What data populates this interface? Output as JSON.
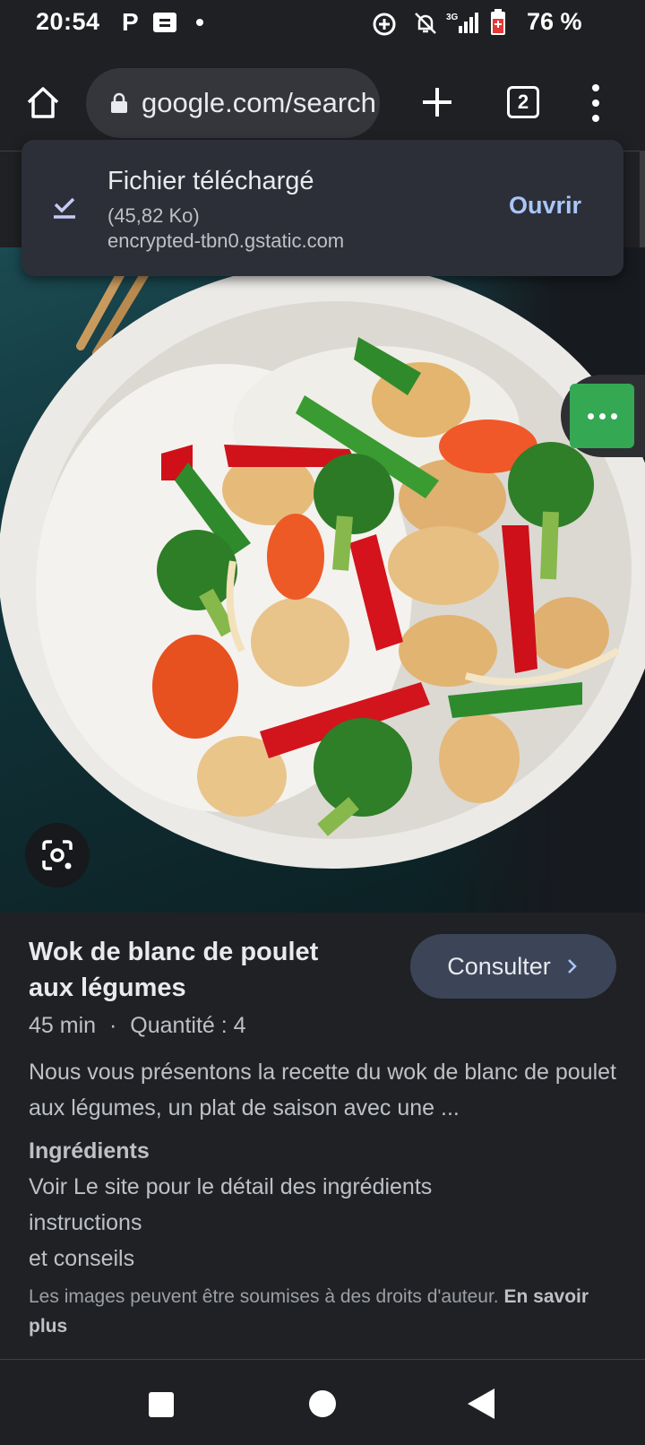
{
  "status_bar": {
    "time": "20:54",
    "left_icons": [
      "p-icon",
      "message-icon",
      "dot-icon"
    ],
    "battery_percent": "76 %",
    "right_icons": [
      "data-saver-icon",
      "notifications-off-icon",
      "signal-3g-icon",
      "battery-icon"
    ]
  },
  "toolbar": {
    "url": "google.com/search",
    "tab_count": "2"
  },
  "snackbar": {
    "title": "Fichier téléchargé",
    "size": "(45,82 Ko)",
    "host": "encrypted-tbn0.gstatic.com",
    "action": "Ouvrir"
  },
  "result": {
    "title": "Wok de blanc de poulet aux légumes",
    "consult_label": "Consulter",
    "time": "45 min",
    "separator": "·",
    "quantity": "Quantité : 4",
    "description": "Nous vous présentons la recette du wok de blanc de poulet aux légumes, un plat de saison avec une ...",
    "ingredients_title": "Ingrédients",
    "ingredients_lines": [
      "Voir Le site pour le détail des ingrédients",
      "instructions",
      "et conseils"
    ],
    "copyright_text": "Les images peuvent être soumises à des droits d'auteur.",
    "copyright_link": "En savoir plus"
  },
  "colors": {
    "background": "#202124",
    "accent_link": "#a8c7fa",
    "fab_green": "#34a853",
    "consult_button": "#3c4458"
  }
}
